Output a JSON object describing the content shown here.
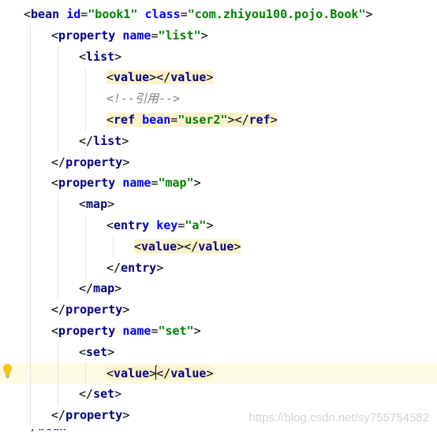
{
  "editor": {
    "lines": [
      {
        "indent": 0,
        "tokens": [
          {
            "t": "<",
            "c": "t-bracket"
          },
          {
            "t": "bean",
            "c": "t-tag"
          },
          {
            "t": " ",
            "c": "t-text"
          },
          {
            "t": "id",
            "c": "t-attr"
          },
          {
            "t": "=",
            "c": "t-eq"
          },
          {
            "t": "\"book1\"",
            "c": "t-str"
          },
          {
            "t": " ",
            "c": "t-text"
          },
          {
            "t": "class",
            "c": "t-attr"
          },
          {
            "t": "=",
            "c": "t-eq"
          },
          {
            "t": "\"com.zhiyou100.pojo.Book\"",
            "c": "t-str"
          },
          {
            "t": ">",
            "c": "t-bracket"
          }
        ]
      },
      {
        "indent": 1,
        "tokens": [
          {
            "t": "<",
            "c": "t-bracket"
          },
          {
            "t": "property",
            "c": "t-tag"
          },
          {
            "t": " ",
            "c": "t-text"
          },
          {
            "t": "name",
            "c": "t-attr"
          },
          {
            "t": "=",
            "c": "t-eq"
          },
          {
            "t": "\"list\"",
            "c": "t-str"
          },
          {
            "t": ">",
            "c": "t-bracket"
          }
        ]
      },
      {
        "indent": 2,
        "tokens": [
          {
            "t": "<",
            "c": "t-bracket"
          },
          {
            "t": "list",
            "c": "t-tag"
          },
          {
            "t": ">",
            "c": "t-bracket"
          }
        ]
      },
      {
        "indent": 3,
        "hl": true,
        "tokens": [
          {
            "t": "<",
            "c": "t-bracket"
          },
          {
            "t": "value",
            "c": "t-tag"
          },
          {
            "t": ">",
            "c": "t-bracket"
          },
          {
            "t": "</",
            "c": "t-bracket"
          },
          {
            "t": "value",
            "c": "t-tag"
          },
          {
            "t": ">",
            "c": "t-bracket"
          }
        ]
      },
      {
        "indent": 3,
        "tokens": [
          {
            "t": "<!--引用-->",
            "c": "t-comment"
          }
        ]
      },
      {
        "indent": 3,
        "hl": true,
        "tokens": [
          {
            "t": "<",
            "c": "t-bracket"
          },
          {
            "t": "ref",
            "c": "t-tag"
          },
          {
            "t": " ",
            "c": "t-text"
          },
          {
            "t": "bean",
            "c": "t-attr"
          },
          {
            "t": "=",
            "c": "t-eq"
          },
          {
            "t": "\"user2\"",
            "c": "t-str"
          },
          {
            "t": ">",
            "c": "t-bracket"
          },
          {
            "t": "</",
            "c": "t-bracket"
          },
          {
            "t": "ref",
            "c": "t-tag"
          },
          {
            "t": ">",
            "c": "t-bracket"
          }
        ]
      },
      {
        "indent": 2,
        "tokens": [
          {
            "t": "</",
            "c": "t-bracket"
          },
          {
            "t": "list",
            "c": "t-tag"
          },
          {
            "t": ">",
            "c": "t-bracket"
          }
        ]
      },
      {
        "indent": 1,
        "tokens": [
          {
            "t": "</",
            "c": "t-bracket"
          },
          {
            "t": "property",
            "c": "t-tag"
          },
          {
            "t": ">",
            "c": "t-bracket"
          }
        ]
      },
      {
        "indent": 1,
        "tokens": [
          {
            "t": "<",
            "c": "t-bracket"
          },
          {
            "t": "property",
            "c": "t-tag"
          },
          {
            "t": " ",
            "c": "t-text"
          },
          {
            "t": "name",
            "c": "t-attr"
          },
          {
            "t": "=",
            "c": "t-eq"
          },
          {
            "t": "\"map\"",
            "c": "t-str"
          },
          {
            "t": ">",
            "c": "t-bracket"
          }
        ]
      },
      {
        "indent": 2,
        "tokens": [
          {
            "t": "<",
            "c": "t-bracket"
          },
          {
            "t": "map",
            "c": "t-tag"
          },
          {
            "t": ">",
            "c": "t-bracket"
          }
        ]
      },
      {
        "indent": 3,
        "tokens": [
          {
            "t": "<",
            "c": "t-bracket"
          },
          {
            "t": "entry",
            "c": "t-tag"
          },
          {
            "t": " ",
            "c": "t-text"
          },
          {
            "t": "key",
            "c": "t-attr"
          },
          {
            "t": "=",
            "c": "t-eq"
          },
          {
            "t": "\"a\"",
            "c": "t-str"
          },
          {
            "t": ">",
            "c": "t-bracket"
          }
        ]
      },
      {
        "indent": 4,
        "hl": true,
        "tokens": [
          {
            "t": "<",
            "c": "t-bracket"
          },
          {
            "t": "value",
            "c": "t-tag"
          },
          {
            "t": ">",
            "c": "t-bracket"
          },
          {
            "t": "</",
            "c": "t-bracket"
          },
          {
            "t": "value",
            "c": "t-tag"
          },
          {
            "t": ">",
            "c": "t-bracket"
          }
        ]
      },
      {
        "indent": 3,
        "tokens": [
          {
            "t": "</",
            "c": "t-bracket"
          },
          {
            "t": "entry",
            "c": "t-tag"
          },
          {
            "t": ">",
            "c": "t-bracket"
          }
        ]
      },
      {
        "indent": 2,
        "tokens": [
          {
            "t": "</",
            "c": "t-bracket"
          },
          {
            "t": "map",
            "c": "t-tag"
          },
          {
            "t": ">",
            "c": "t-bracket"
          }
        ]
      },
      {
        "indent": 1,
        "tokens": [
          {
            "t": "</",
            "c": "t-bracket"
          },
          {
            "t": "property",
            "c": "t-tag"
          },
          {
            "t": ">",
            "c": "t-bracket"
          }
        ]
      },
      {
        "indent": 1,
        "tokens": [
          {
            "t": "<",
            "c": "t-bracket"
          },
          {
            "t": "property",
            "c": "t-tag"
          },
          {
            "t": " ",
            "c": "t-text"
          },
          {
            "t": "name",
            "c": "t-attr"
          },
          {
            "t": "=",
            "c": "t-eq"
          },
          {
            "t": "\"set\"",
            "c": "t-str"
          },
          {
            "t": ">",
            "c": "t-bracket"
          }
        ]
      },
      {
        "indent": 2,
        "tokens": [
          {
            "t": "<",
            "c": "t-bracket"
          },
          {
            "t": "set",
            "c": "t-tag"
          },
          {
            "t": ">",
            "c": "t-bracket"
          }
        ]
      },
      {
        "indent": 3,
        "hl": true,
        "current": true,
        "caret_after_token": 2,
        "tokens": [
          {
            "t": "<",
            "c": "t-bracket"
          },
          {
            "t": "value",
            "c": "t-tag"
          },
          {
            "t": ">",
            "c": "t-bracket"
          },
          {
            "t": "</",
            "c": "t-bracket"
          },
          {
            "t": "value",
            "c": "t-tag"
          },
          {
            "t": ">",
            "c": "t-bracket"
          }
        ]
      },
      {
        "indent": 2,
        "tokens": [
          {
            "t": "</",
            "c": "t-bracket"
          },
          {
            "t": "set",
            "c": "t-tag"
          },
          {
            "t": ">",
            "c": "t-bracket"
          }
        ]
      },
      {
        "indent": 1,
        "tokens": [
          {
            "t": "</",
            "c": "t-bracket"
          },
          {
            "t": "property",
            "c": "t-tag"
          },
          {
            "t": ">",
            "c": "t-bracket"
          }
        ]
      }
    ],
    "partial_last_line": [
      {
        "t": "</",
        "c": "t-bracket"
      },
      {
        "t": "bean",
        "c": "t-tag"
      },
      {
        "t": ">",
        "c": "t-bracket"
      }
    ]
  },
  "gutter": {
    "icon": "intention-bulb-icon",
    "color": "#f5c518"
  },
  "colors": {
    "tag": "#000080",
    "attribute": "#0000ff",
    "string": "#008000",
    "comment": "#808080",
    "highlight": "#fbf3ce",
    "current_line": "#fdfbe3"
  },
  "watermark": {
    "text": "https://blog.csdn.net/sy755754582"
  }
}
